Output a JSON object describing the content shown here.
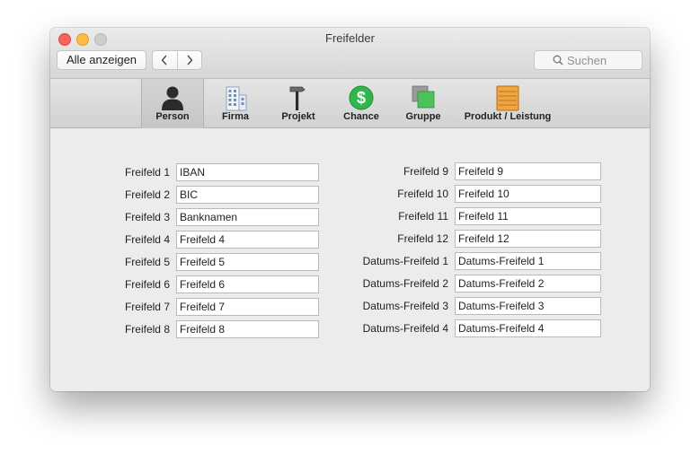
{
  "window": {
    "title": "Freifelder"
  },
  "toolbar": {
    "show_all_label": "Alle anzeigen",
    "back_label": "<",
    "forward_label": ">",
    "search_placeholder": "Suchen"
  },
  "tabs": [
    {
      "id": "person",
      "label": "Person",
      "icon": "person-icon",
      "selected": true
    },
    {
      "id": "firma",
      "label": "Firma",
      "icon": "building-icon",
      "selected": false
    },
    {
      "id": "projekt",
      "label": "Projekt",
      "icon": "hammer-icon",
      "selected": false
    },
    {
      "id": "chance",
      "label": "Chance",
      "icon": "dollar-icon",
      "selected": false
    },
    {
      "id": "gruppe",
      "label": "Gruppe",
      "icon": "group-icon",
      "selected": false
    },
    {
      "id": "produkt",
      "label": "Produkt / Leistung",
      "icon": "crate-icon",
      "selected": false
    }
  ],
  "left_fields": [
    {
      "label": "Freifeld 1",
      "value": "IBAN"
    },
    {
      "label": "Freifeld 2",
      "value": "BIC"
    },
    {
      "label": "Freifeld 3",
      "value": "Banknamen"
    },
    {
      "label": "Freifeld 4",
      "value": "Freifeld 4"
    },
    {
      "label": "Freifeld 5",
      "value": "Freifeld 5"
    },
    {
      "label": "Freifeld 6",
      "value": "Freifeld 6"
    },
    {
      "label": "Freifeld 7",
      "value": "Freifeld 7"
    },
    {
      "label": "Freifeld 8",
      "value": "Freifeld 8"
    }
  ],
  "right_fields": [
    {
      "label": "Freifeld 9",
      "value": "Freifeld 9"
    },
    {
      "label": "Freifeld 10",
      "value": "Freifeld 10"
    },
    {
      "label": "Freifeld 11",
      "value": "Freifeld 11"
    },
    {
      "label": "Freifeld 12",
      "value": "Freifeld 12"
    },
    {
      "label": "Datums-Freifeld 1",
      "value": "Datums-Freifeld 1"
    },
    {
      "label": "Datums-Freifeld 2",
      "value": "Datums-Freifeld 2"
    },
    {
      "label": "Datums-Freifeld 3",
      "value": "Datums-Freifeld 3"
    },
    {
      "label": "Datums-Freifeld 4",
      "value": "Datums-Freifeld 4"
    }
  ],
  "colors": {
    "close": "#fc605c",
    "minimize": "#fdbc40",
    "zoom": "#cdcdcd",
    "chance_green": "#2fb84a",
    "gruppe_green": "#4cc25c",
    "crate_orange": "#f0a640"
  }
}
